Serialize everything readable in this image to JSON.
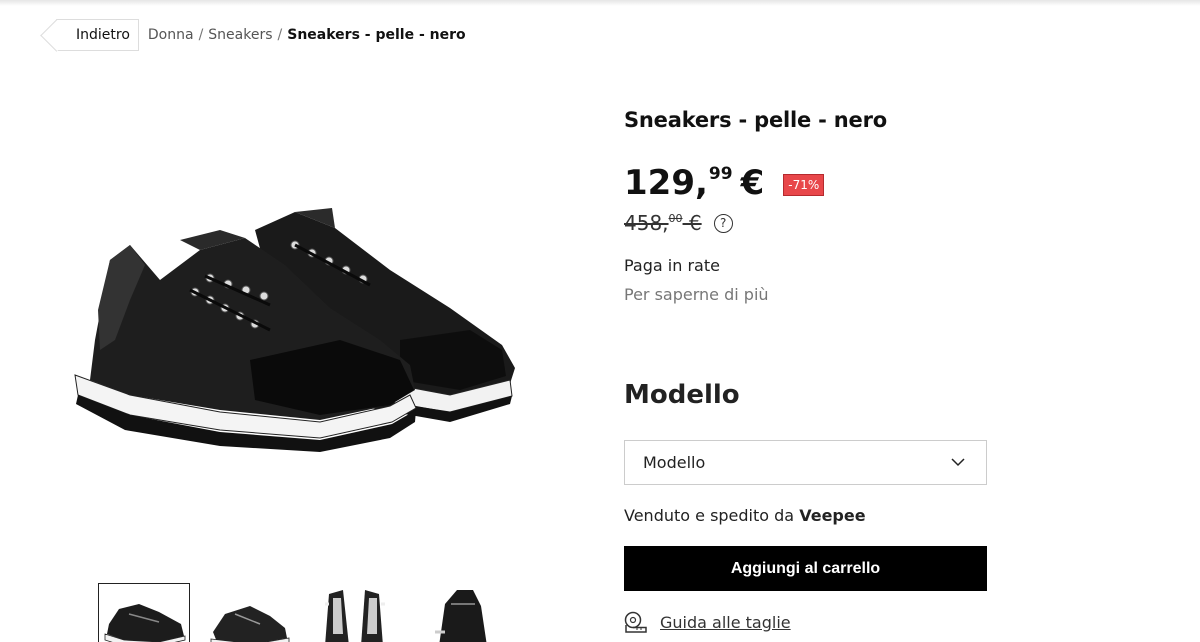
{
  "breadcrumb": {
    "back_label": "Indietro",
    "items": [
      "Donna",
      "Sneakers"
    ],
    "current": "Sneakers - pelle - nero"
  },
  "product": {
    "title": "Sneakers - pelle - nero",
    "price_int": "129,",
    "price_dec": "99",
    "price_currency": "€",
    "discount": "-71%",
    "old_price_int": "458,",
    "old_price_dec": "00",
    "old_price_currency": " €",
    "help_icon": "?",
    "installments_title": "Paga in rate",
    "installments_link": "Per saperne di più",
    "model_heading": "Modello",
    "model_select_value": "Modello",
    "sold_by_prefix": "Venduto e spedito da ",
    "sold_by_name": "Veepee",
    "add_to_cart": "Aggiungi al carrello",
    "size_guide": "Guida alle taglie"
  },
  "thumbnails": [
    {
      "name": "thumb-1",
      "active": true
    },
    {
      "name": "thumb-2",
      "active": false
    },
    {
      "name": "thumb-3",
      "active": false
    },
    {
      "name": "thumb-4",
      "active": false
    }
  ],
  "colors": {
    "discount_bg": "#e8474a",
    "button_bg": "#000000",
    "muted_text": "#777777"
  }
}
